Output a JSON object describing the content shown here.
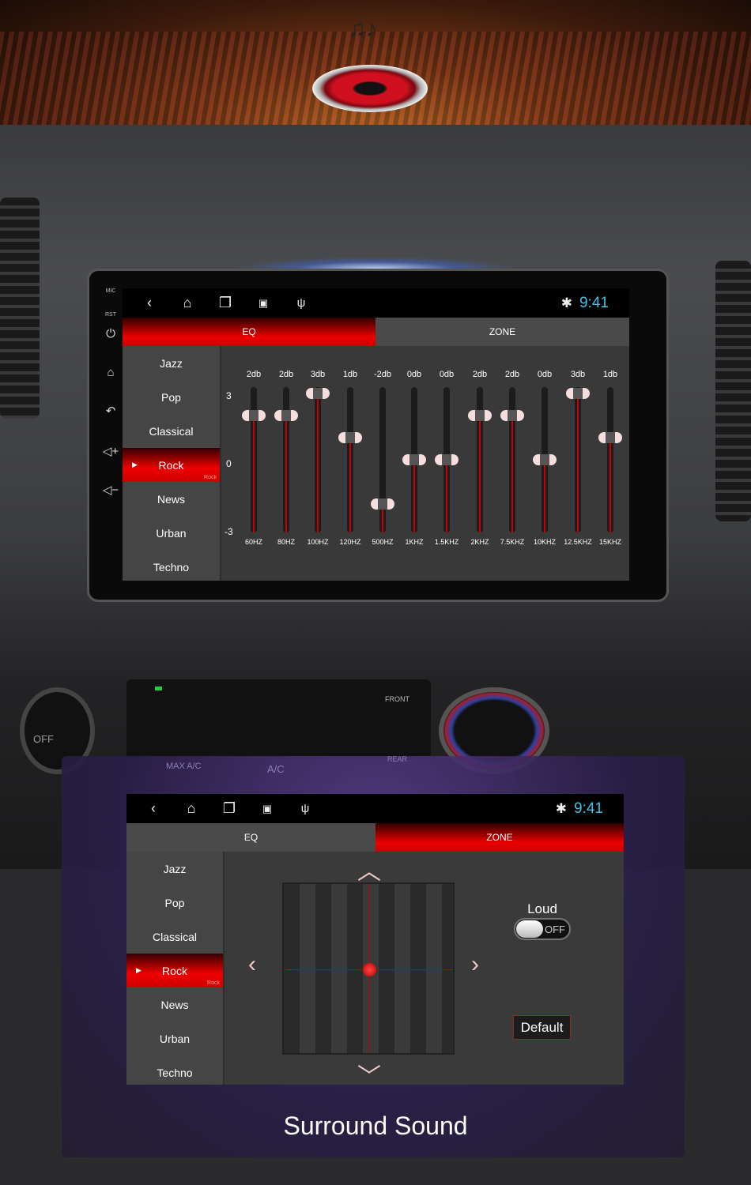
{
  "banner": {
    "notes_glyph": "♫♪",
    "speaker_icon": "red-speaker-icon"
  },
  "head_unit": {
    "side_labels": [
      "MIC",
      "RST"
    ],
    "side_icons": [
      "power-icon",
      "home-icon",
      "back-icon",
      "volume-up-icon",
      "volume-down-icon"
    ]
  },
  "status_bar": {
    "time": "9:41",
    "icons": [
      "back-icon",
      "home-icon",
      "recent-apps-icon",
      "gallery-icon",
      "usb-icon",
      "bluetooth-icon"
    ]
  },
  "tabs": [
    {
      "label": "EQ"
    },
    {
      "label": "ZONE"
    }
  ],
  "presets": [
    {
      "label": "Jazz"
    },
    {
      "label": "Pop"
    },
    {
      "label": "Classical"
    },
    {
      "label": "Rock"
    },
    {
      "label": "News"
    },
    {
      "label": "Urban"
    },
    {
      "label": "Techno"
    }
  ],
  "selected_preset": "Rock",
  "eq": {
    "axis": [
      "3",
      "0",
      "-3"
    ],
    "range": [
      -3,
      3
    ],
    "bands": [
      {
        "freq": "60HZ",
        "label": "2db",
        "value": 2
      },
      {
        "freq": "80HZ",
        "label": "2db",
        "value": 2
      },
      {
        "freq": "100HZ",
        "label": "3db",
        "value": 3
      },
      {
        "freq": "120HZ",
        "label": "1db",
        "value": 1
      },
      {
        "freq": "500HZ",
        "label": "-2db",
        "value": -2
      },
      {
        "freq": "1KHZ",
        "label": "0db",
        "value": 0
      },
      {
        "freq": "1.5KHZ",
        "label": "0db",
        "value": 0
      },
      {
        "freq": "2KHZ",
        "label": "2db",
        "value": 2
      },
      {
        "freq": "7.5KHZ",
        "label": "2db",
        "value": 2
      },
      {
        "freq": "10KHZ",
        "label": "0db",
        "value": 0
      },
      {
        "freq": "12.5KHZ",
        "label": "3db",
        "value": 3
      },
      {
        "freq": "15KHZ",
        "label": "1db",
        "value": 1
      }
    ]
  },
  "climate": {
    "off_label": "OFF",
    "front_label": "FRONT",
    "rear_label": "REAR",
    "ac_label": "A/C",
    "max_label": "MAX A/C"
  },
  "zone": {
    "loud_label": "Loud",
    "loud_state": "OFF",
    "default_label": "Default",
    "arrows": [
      "up",
      "left",
      "right",
      "down"
    ]
  },
  "caption": "Surround Sound",
  "colors": {
    "accent_red": "#e00000",
    "time_blue": "#3fc2e6"
  }
}
